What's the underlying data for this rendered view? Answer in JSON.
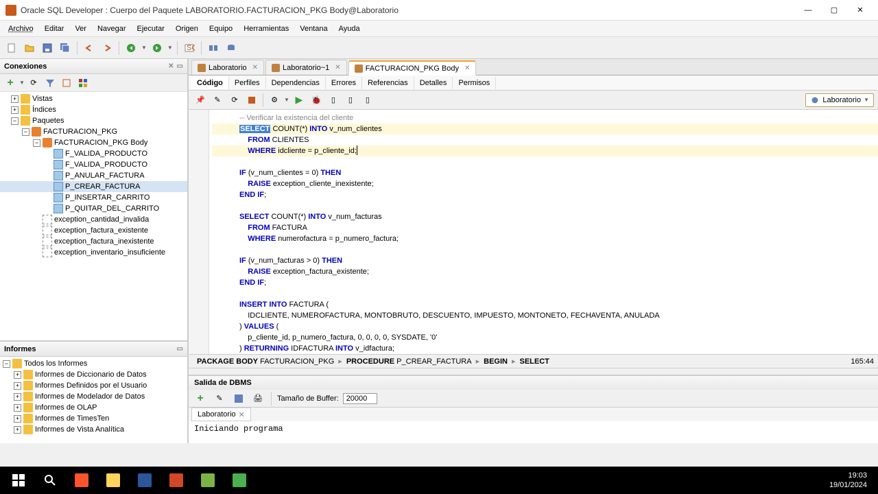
{
  "window": {
    "title": "Oracle SQL Developer : Cuerpo del Paquete LABORATORIO.FACTURACION_PKG Body@Laboratorio"
  },
  "menubar": [
    "Archivo",
    "Editar",
    "Ver",
    "Navegar",
    "Ejecutar",
    "Origen",
    "Equipo",
    "Herramientas",
    "Ventana",
    "Ayuda"
  ],
  "connections": {
    "title": "Conexiones",
    "tree": [
      {
        "level": 1,
        "toggle": "+",
        "icon": "folder",
        "label": "Vistas"
      },
      {
        "level": 1,
        "toggle": "+",
        "icon": "folder",
        "label": "Índices"
      },
      {
        "level": 1,
        "toggle": "-",
        "icon": "folder",
        "label": "Paquetes"
      },
      {
        "level": 2,
        "toggle": "-",
        "icon": "pkg",
        "label": "FACTURACION_PKG"
      },
      {
        "level": 3,
        "toggle": "-",
        "icon": "pkg",
        "label": "FACTURACION_PKG Body"
      },
      {
        "level": 4,
        "toggle": "",
        "icon": "proc",
        "label": "F_VALIDA_PRODUCTO"
      },
      {
        "level": 4,
        "toggle": "",
        "icon": "proc",
        "label": "F_VALIDA_PRODUCTO"
      },
      {
        "level": 4,
        "toggle": "",
        "icon": "proc",
        "label": "P_ANULAR_FACTURA"
      },
      {
        "level": 4,
        "toggle": "",
        "icon": "proc",
        "label": "P_CREAR_FACTURA",
        "selected": true
      },
      {
        "level": 4,
        "toggle": "",
        "icon": "proc",
        "label": "P_INSERTAR_CARRITO"
      },
      {
        "level": 4,
        "toggle": "",
        "icon": "proc",
        "label": "P_QUITAR_DEL_CARRITO"
      },
      {
        "level": 3,
        "toggle": "",
        "icon": "exc",
        "label": "exception_cantidad_invalida"
      },
      {
        "level": 3,
        "toggle": "",
        "icon": "exc",
        "label": "exception_factura_existente"
      },
      {
        "level": 3,
        "toggle": "",
        "icon": "exc",
        "label": "exception_factura_inexistente"
      },
      {
        "level": 3,
        "toggle": "",
        "icon": "exc",
        "label": "exception_inventario_insuficiente"
      }
    ]
  },
  "informes": {
    "title": "Informes",
    "tree": [
      {
        "level": 0,
        "toggle": "-",
        "icon": "folder",
        "label": "Todos los Informes"
      },
      {
        "level": 1,
        "toggle": "+",
        "icon": "folder",
        "label": "Informes de Diccionario de Datos"
      },
      {
        "level": 1,
        "toggle": "+",
        "icon": "folder",
        "label": "Informes Definidos por el Usuario"
      },
      {
        "level": 1,
        "toggle": "+",
        "icon": "folder",
        "label": "Informes de Modelador de Datos"
      },
      {
        "level": 1,
        "toggle": "+",
        "icon": "folder",
        "label": "Informes de OLAP"
      },
      {
        "level": 1,
        "toggle": "+",
        "icon": "folder",
        "label": "Informes de TimesTen"
      },
      {
        "level": 1,
        "toggle": "+",
        "icon": "folder",
        "label": "Informes de Vista Analítica"
      }
    ]
  },
  "editor": {
    "tabs": [
      {
        "label": "Laboratorio",
        "active": false
      },
      {
        "label": "Laboratorio~1",
        "active": false
      },
      {
        "label": "FACTURACION_PKG Body",
        "active": true
      }
    ],
    "subtabs": [
      "Código",
      "Perfiles",
      "Dependencias",
      "Errores",
      "Referencias",
      "Detalles",
      "Permisos"
    ],
    "active_subtab": "Código",
    "connection": "Laboratorio",
    "cursor_pos": "165:44"
  },
  "breadcrumb": [
    {
      "bold": "PACKAGE BODY",
      "text": "FACTURACION_PKG"
    },
    {
      "bold": "PROCEDURE",
      "text": "P_CREAR_FACTURA"
    },
    {
      "bold": "BEGIN",
      "text": ""
    },
    {
      "bold": "SELECT",
      "text": ""
    }
  ],
  "dbms": {
    "title": "Salida de DBMS",
    "buffer_label": "Tamaño de Buffer:",
    "buffer_value": "20000",
    "tab": "Laboratorio",
    "output": "Iniciando programa"
  },
  "taskbar": {
    "time": "19:03",
    "date": "19/01/2024"
  }
}
